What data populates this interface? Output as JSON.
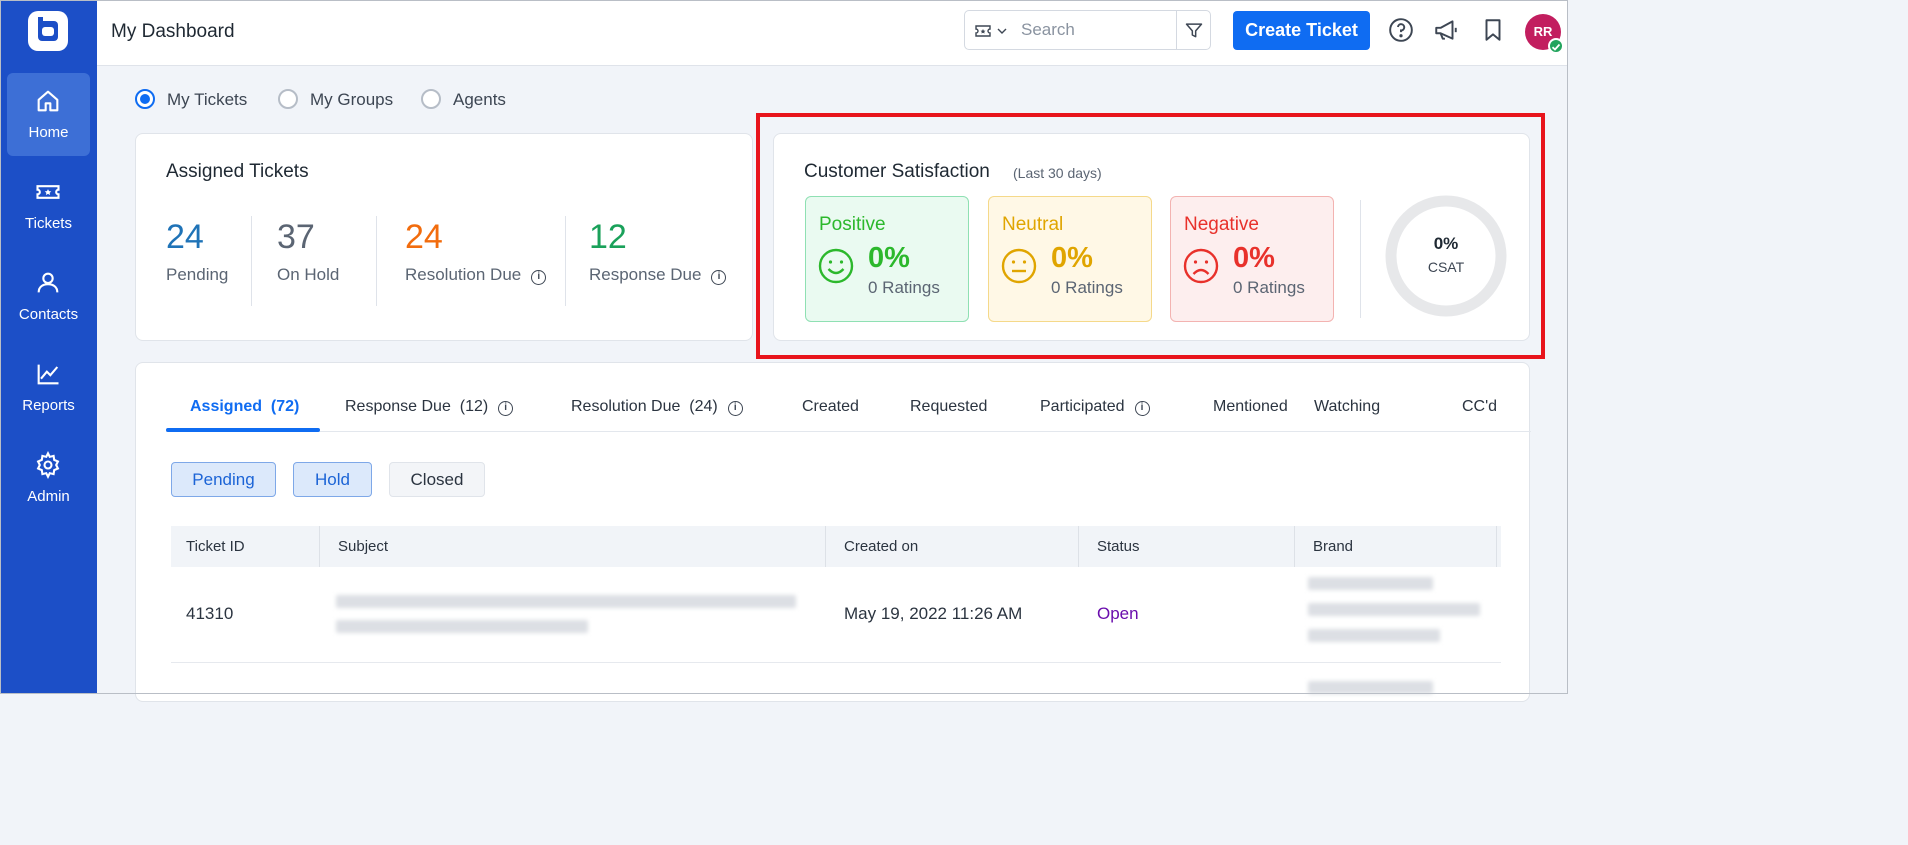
{
  "sidebar": {
    "items": [
      {
        "label": "Home",
        "icon": "home-icon",
        "active": true
      },
      {
        "label": "Tickets",
        "icon": "ticket-icon",
        "active": false
      },
      {
        "label": "Contacts",
        "icon": "user-icon",
        "active": false
      },
      {
        "label": "Reports",
        "icon": "chart-icon",
        "active": false
      },
      {
        "label": "Admin",
        "icon": "gear-icon",
        "active": false
      }
    ]
  },
  "header": {
    "title": "My Dashboard",
    "search_placeholder": "Search",
    "create_label": "Create Ticket",
    "avatar_initials": "RR"
  },
  "view_options": {
    "selected": "My Tickets",
    "items": [
      "My Tickets",
      "My Groups",
      "Agents"
    ]
  },
  "assigned_tickets": {
    "title": "Assigned Tickets",
    "stats": [
      {
        "value": "24",
        "label": "Pending",
        "color": "#1f73b7"
      },
      {
        "value": "37",
        "label": "On Hold",
        "color": "#5b6573"
      },
      {
        "value": "24",
        "label": "Resolution Due",
        "color": "#f26c0d"
      },
      {
        "value": "12",
        "label": "Response Due",
        "color": "#1aa15a"
      }
    ]
  },
  "customer_satisfaction": {
    "title": "Customer Satisfaction",
    "period": "(Last 30 days)",
    "boxes": [
      {
        "label": "Positive",
        "percent": "0%",
        "ratings": "0 Ratings",
        "accent": "#2cb82c",
        "bg": "#eafaf1",
        "border": "#8fe0b3"
      },
      {
        "label": "Neutral",
        "percent": "0%",
        "ratings": "0 Ratings",
        "accent": "#e0a500",
        "bg": "#fff8e6",
        "border": "#f5d98a"
      },
      {
        "label": "Negative",
        "percent": "0%",
        "ratings": "0 Ratings",
        "accent": "#e8312b",
        "bg": "#fdeeee",
        "border": "#f3b3b1"
      }
    ],
    "csat_percent": "0%",
    "csat_label": "CSAT"
  },
  "tabs": [
    {
      "label": "Assigned",
      "count": "(72)",
      "active": true
    },
    {
      "label": "Response Due",
      "count": "(12)",
      "info": true
    },
    {
      "label": "Resolution Due",
      "count": "(24)",
      "info": true
    },
    {
      "label": "Created"
    },
    {
      "label": "Requested"
    },
    {
      "label": "Participated",
      "info": true
    },
    {
      "label": "Mentioned"
    },
    {
      "label": "Watching"
    },
    {
      "label": "CC'd"
    }
  ],
  "status_filters": [
    {
      "label": "Pending",
      "active": true
    },
    {
      "label": "Hold",
      "active": true
    },
    {
      "label": "Closed",
      "active": false
    }
  ],
  "table": {
    "columns": [
      "Ticket ID",
      "Subject",
      "Created on",
      "Status",
      "Brand"
    ],
    "rows": [
      {
        "ticket_id": "41310",
        "created_on": "May 19, 2022 11:26 AM",
        "status": "Open",
        "status_color": "#6a0dad"
      }
    ]
  }
}
